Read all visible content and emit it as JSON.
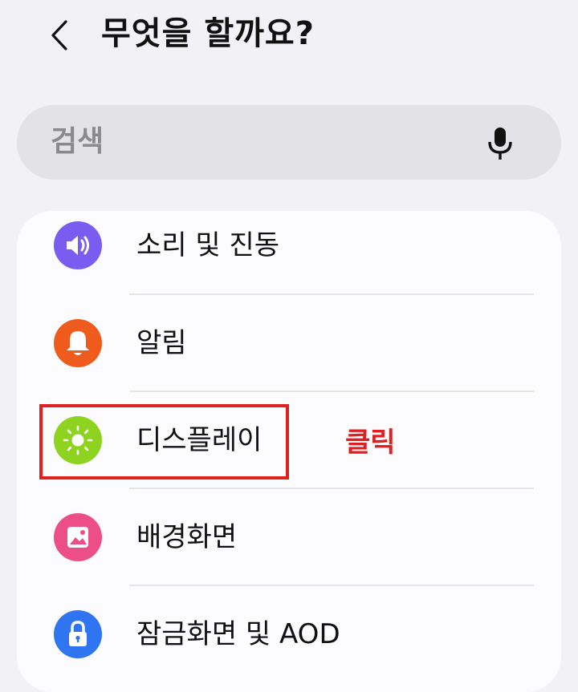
{
  "header": {
    "title": "무엇을 할까요?"
  },
  "search": {
    "placeholder": "검색"
  },
  "settings": {
    "items": [
      {
        "label": "소리 및 진동",
        "icon": "speaker-icon",
        "color": "#7a5cf0"
      },
      {
        "label": "알림",
        "icon": "bell-icon",
        "color": "#ef5b1c"
      },
      {
        "label": "디스플레이",
        "icon": "sun-icon",
        "color": "#8dd31f"
      },
      {
        "label": "배경화면",
        "icon": "image-icon",
        "color": "#ec4f86"
      },
      {
        "label": "잠금화면 및 AOD",
        "icon": "lock-icon",
        "color": "#2f74f0"
      }
    ]
  },
  "annotation": {
    "click_label": "클릭",
    "color": "#e02020"
  }
}
